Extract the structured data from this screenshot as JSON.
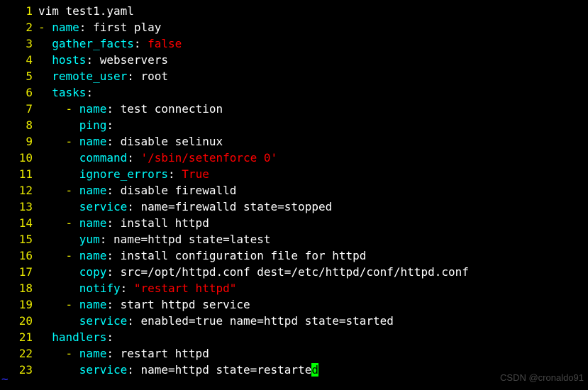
{
  "watermark": "CSDN @cronaldo91",
  "lines": [
    {
      "ln": "1",
      "tokens": [
        {
          "t": "vim test1.yaml",
          "c": "k-white"
        }
      ]
    },
    {
      "ln": "2",
      "tokens": [
        {
          "t": "- ",
          "c": "k-dash"
        },
        {
          "t": "name",
          "c": "k-cyan"
        },
        {
          "t": ": ",
          "c": "k-white"
        },
        {
          "t": "first play",
          "c": "k-white"
        }
      ]
    },
    {
      "ln": "3",
      "tokens": [
        {
          "t": "  ",
          "c": "k-white"
        },
        {
          "t": "gather_facts",
          "c": "k-cyan"
        },
        {
          "t": ": ",
          "c": "k-white"
        },
        {
          "t": "false",
          "c": "k-red"
        }
      ]
    },
    {
      "ln": "4",
      "tokens": [
        {
          "t": "  ",
          "c": "k-white"
        },
        {
          "t": "hosts",
          "c": "k-cyan"
        },
        {
          "t": ": ",
          "c": "k-white"
        },
        {
          "t": "webservers",
          "c": "k-white"
        }
      ]
    },
    {
      "ln": "5",
      "tokens": [
        {
          "t": "  ",
          "c": "k-white"
        },
        {
          "t": "remote_user",
          "c": "k-cyan"
        },
        {
          "t": ": ",
          "c": "k-white"
        },
        {
          "t": "root",
          "c": "k-white"
        }
      ]
    },
    {
      "ln": "6",
      "tokens": [
        {
          "t": "  ",
          "c": "k-white"
        },
        {
          "t": "tasks",
          "c": "k-cyan"
        },
        {
          "t": ":",
          "c": "k-white"
        }
      ]
    },
    {
      "ln": "7",
      "tokens": [
        {
          "t": "    ",
          "c": "k-white"
        },
        {
          "t": "- ",
          "c": "k-dash"
        },
        {
          "t": "name",
          "c": "k-cyan"
        },
        {
          "t": ": ",
          "c": "k-white"
        },
        {
          "t": "test connection",
          "c": "k-white"
        }
      ]
    },
    {
      "ln": "8",
      "tokens": [
        {
          "t": "      ",
          "c": "k-white"
        },
        {
          "t": "ping",
          "c": "k-cyan"
        },
        {
          "t": ":",
          "c": "k-white"
        }
      ]
    },
    {
      "ln": "9",
      "tokens": [
        {
          "t": "    ",
          "c": "k-white"
        },
        {
          "t": "- ",
          "c": "k-dash"
        },
        {
          "t": "name",
          "c": "k-cyan"
        },
        {
          "t": ": ",
          "c": "k-white"
        },
        {
          "t": "disable selinux",
          "c": "k-white"
        }
      ]
    },
    {
      "ln": "10",
      "tokens": [
        {
          "t": "      ",
          "c": "k-white"
        },
        {
          "t": "command",
          "c": "k-cyan"
        },
        {
          "t": ": ",
          "c": "k-white"
        },
        {
          "t": "'/sbin/setenforce 0'",
          "c": "k-red"
        }
      ]
    },
    {
      "ln": "11",
      "tokens": [
        {
          "t": "      ",
          "c": "k-white"
        },
        {
          "t": "ignore_errors",
          "c": "k-cyan"
        },
        {
          "t": ": ",
          "c": "k-white"
        },
        {
          "t": "True",
          "c": "k-red"
        }
      ]
    },
    {
      "ln": "12",
      "tokens": [
        {
          "t": "    ",
          "c": "k-white"
        },
        {
          "t": "- ",
          "c": "k-dash"
        },
        {
          "t": "name",
          "c": "k-cyan"
        },
        {
          "t": ": ",
          "c": "k-white"
        },
        {
          "t": "disable firewalld",
          "c": "k-white"
        }
      ]
    },
    {
      "ln": "13",
      "tokens": [
        {
          "t": "      ",
          "c": "k-white"
        },
        {
          "t": "service",
          "c": "k-cyan"
        },
        {
          "t": ": ",
          "c": "k-white"
        },
        {
          "t": "name=firewalld state=stopped",
          "c": "k-white"
        }
      ]
    },
    {
      "ln": "14",
      "tokens": [
        {
          "t": "    ",
          "c": "k-white"
        },
        {
          "t": "- ",
          "c": "k-dash"
        },
        {
          "t": "name",
          "c": "k-cyan"
        },
        {
          "t": ": ",
          "c": "k-white"
        },
        {
          "t": "install httpd",
          "c": "k-white"
        }
      ]
    },
    {
      "ln": "15",
      "tokens": [
        {
          "t": "      ",
          "c": "k-white"
        },
        {
          "t": "yum",
          "c": "k-cyan"
        },
        {
          "t": ": ",
          "c": "k-white"
        },
        {
          "t": "name=httpd state=latest",
          "c": "k-white"
        }
      ]
    },
    {
      "ln": "16",
      "tokens": [
        {
          "t": "    ",
          "c": "k-white"
        },
        {
          "t": "- ",
          "c": "k-dash"
        },
        {
          "t": "name",
          "c": "k-cyan"
        },
        {
          "t": ": ",
          "c": "k-white"
        },
        {
          "t": "install configuration file for httpd",
          "c": "k-white"
        }
      ]
    },
    {
      "ln": "17",
      "tokens": [
        {
          "t": "      ",
          "c": "k-white"
        },
        {
          "t": "copy",
          "c": "k-cyan"
        },
        {
          "t": ": ",
          "c": "k-white"
        },
        {
          "t": "src=/opt/httpd.conf dest=/etc/httpd/conf/httpd.conf",
          "c": "k-white"
        }
      ]
    },
    {
      "ln": "18",
      "tokens": [
        {
          "t": "      ",
          "c": "k-white"
        },
        {
          "t": "notify",
          "c": "k-cyan"
        },
        {
          "t": ": ",
          "c": "k-white"
        },
        {
          "t": "\"restart httpd\"",
          "c": "k-red"
        }
      ]
    },
    {
      "ln": "19",
      "tokens": [
        {
          "t": "    ",
          "c": "k-white"
        },
        {
          "t": "- ",
          "c": "k-dash"
        },
        {
          "t": "name",
          "c": "k-cyan"
        },
        {
          "t": ": ",
          "c": "k-white"
        },
        {
          "t": "start httpd service",
          "c": "k-white"
        }
      ]
    },
    {
      "ln": "20",
      "tokens": [
        {
          "t": "      ",
          "c": "k-white"
        },
        {
          "t": "service",
          "c": "k-cyan"
        },
        {
          "t": ": ",
          "c": "k-white"
        },
        {
          "t": "enabled=true name=httpd state=started",
          "c": "k-white"
        }
      ]
    },
    {
      "ln": "21",
      "tokens": [
        {
          "t": "  ",
          "c": "k-white"
        },
        {
          "t": "handlers",
          "c": "k-cyan"
        },
        {
          "t": ":",
          "c": "k-white"
        }
      ]
    },
    {
      "ln": "22",
      "tokens": [
        {
          "t": "    ",
          "c": "k-white"
        },
        {
          "t": "- ",
          "c": "k-dash"
        },
        {
          "t": "name",
          "c": "k-cyan"
        },
        {
          "t": ": ",
          "c": "k-white"
        },
        {
          "t": "restart httpd",
          "c": "k-white"
        }
      ]
    },
    {
      "ln": "23",
      "tokens": [
        {
          "t": "      ",
          "c": "k-white"
        },
        {
          "t": "service",
          "c": "k-cyan"
        },
        {
          "t": ": ",
          "c": "k-white"
        },
        {
          "t": "name=httpd state=restarte",
          "c": "k-white"
        },
        {
          "t": "d",
          "c": "cursor"
        }
      ]
    }
  ],
  "tilde": "~"
}
